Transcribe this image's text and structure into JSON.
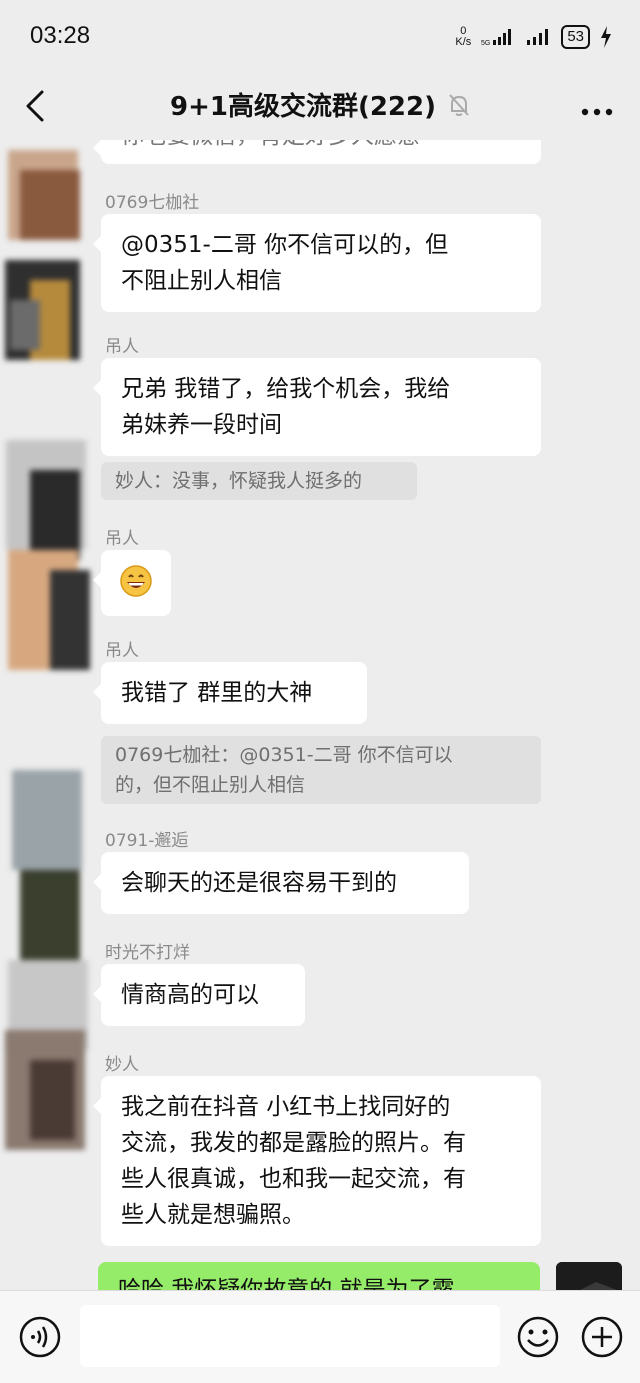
{
  "status_bar": {
    "time": "03:28",
    "net_speed_value": "0",
    "net_speed_unit": "K/s",
    "battery": "53"
  },
  "header": {
    "title": "9+1高级交流群(222)"
  },
  "messages": [
    {
      "type": "text-partial",
      "text": "你老婆微信，肯定好多人愿意"
    },
    {
      "sender": "0769七枷社",
      "lines": [
        "@0351-二哥  你不信可以的，但",
        "不阻止别人相信"
      ]
    },
    {
      "sender": "吊人",
      "lines": [
        "兄弟 我错了，给我个机会，我给",
        "弟妹养一段时间"
      ],
      "quote": "妙人：没事，怀疑我人挺多的"
    },
    {
      "sender": "吊人",
      "emoji": "😄"
    },
    {
      "sender": "吊人",
      "lines": [
        "我错了 群里的大神"
      ],
      "quote_lines": [
        "0769七枷社：@0351-二哥 你不信可以",
        "的，但不阻止别人相信"
      ]
    },
    {
      "sender": "0791-邂逅",
      "lines": [
        "会聊天的还是很容易干到的"
      ]
    },
    {
      "sender": "时光不打烊",
      "lines": [
        "情商高的可以"
      ]
    },
    {
      "sender": "妙人",
      "lines": [
        "我之前在抖音 小红书上找同好的",
        "交流，我发的都是露脸的照片。有",
        "些人很真诚，也和我一起交流，有",
        "些人就是想骗照。"
      ]
    },
    {
      "self": true,
      "text": "哈哈 我怀疑你故意的 就是为了露"
    }
  ],
  "colors": {
    "background": "#ededed",
    "bubble_incoming": "#ffffff",
    "bubble_outgoing": "#95ec69",
    "quote_bg": "#e0e0e0",
    "sender_name": "#8a8a8a"
  },
  "icons": {
    "back": "chevron-left-icon",
    "muted": "bell-off-icon",
    "more": "more-dots-icon",
    "voice": "voice-icon",
    "emoji": "emoji-icon",
    "add": "plus-icon"
  }
}
